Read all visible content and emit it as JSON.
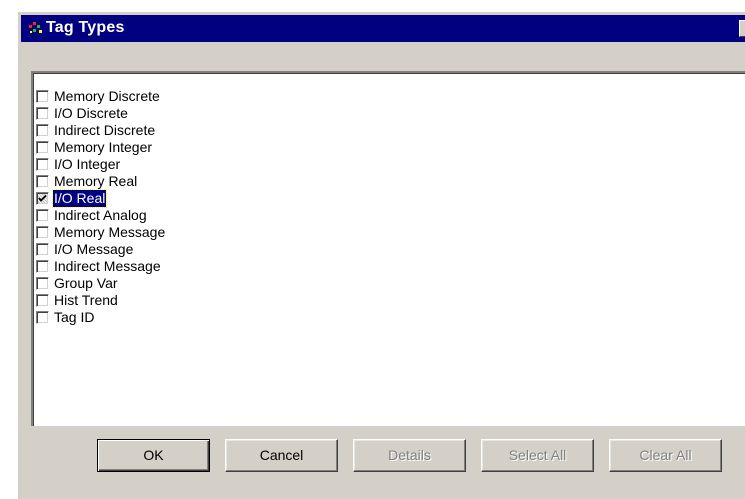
{
  "window": {
    "title": "Tag Types"
  },
  "list": {
    "items": [
      {
        "label": "Memory Discrete",
        "checked": false,
        "selected": false
      },
      {
        "label": "I/O Discrete",
        "checked": false,
        "selected": false
      },
      {
        "label": "Indirect Discrete",
        "checked": false,
        "selected": false
      },
      {
        "label": "Memory Integer",
        "checked": false,
        "selected": false
      },
      {
        "label": "I/O Integer",
        "checked": false,
        "selected": false
      },
      {
        "label": "Memory Real",
        "checked": false,
        "selected": false
      },
      {
        "label": "I/O Real",
        "checked": true,
        "selected": true
      },
      {
        "label": "Indirect Analog",
        "checked": false,
        "selected": false
      },
      {
        "label": "Memory Message",
        "checked": false,
        "selected": false
      },
      {
        "label": "I/O Message",
        "checked": false,
        "selected": false
      },
      {
        "label": "Indirect Message",
        "checked": false,
        "selected": false
      },
      {
        "label": "Group Var",
        "checked": false,
        "selected": false
      },
      {
        "label": "Hist Trend",
        "checked": false,
        "selected": false
      },
      {
        "label": "Tag ID",
        "checked": false,
        "selected": false
      }
    ]
  },
  "buttons": {
    "ok": "OK",
    "cancel": "Cancel",
    "details": "Details",
    "select_all": "Select All",
    "clear_all": "Clear All"
  },
  "colors": {
    "titlebar": "#000080",
    "dialog_face": "#d4d0c8",
    "selection": "#000080",
    "disabled_text": "#808080"
  },
  "icons": {
    "app": "tagname-dictionary-icon",
    "check": "checkmark-icon"
  }
}
